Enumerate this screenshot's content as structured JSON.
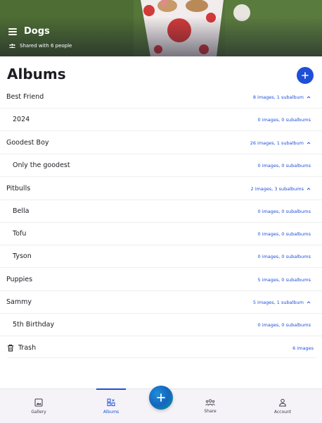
{
  "header": {
    "title": "Dogs",
    "shared_text": "Shared with 6 people",
    "menu_icon": "hamburger-icon",
    "shared_icon": "group-icon"
  },
  "albums": {
    "title": "Albums",
    "add_icon": "plus-icon",
    "items": [
      {
        "name": "Best Friend",
        "meta": "8 images, 1 subalbum",
        "expanded": true,
        "level": 0
      },
      {
        "name": "2024",
        "meta": "0 images, 0 subalbums",
        "level": 1
      },
      {
        "name": "Goodest Boy",
        "meta": "26 images, 1 subalbum",
        "expanded": true,
        "level": 0
      },
      {
        "name": "Only the goodest",
        "meta": "0 images, 0 subalbums",
        "level": 1
      },
      {
        "name": "Pitbulls",
        "meta": "2 images, 3 subalbums",
        "expanded": true,
        "level": 0
      },
      {
        "name": "Bella",
        "meta": "0 images, 0 subalbums",
        "level": 1
      },
      {
        "name": "Tofu",
        "meta": "0 images, 0 subalbums",
        "level": 1
      },
      {
        "name": "Tyson",
        "meta": "0 images, 0 subalbums",
        "level": 1
      },
      {
        "name": "Puppies",
        "meta": "5 images, 0 subalbums",
        "level": 0
      },
      {
        "name": "Sammy",
        "meta": "5 images, 1 subalbum",
        "expanded": true,
        "level": 0
      },
      {
        "name": "5th Birthday",
        "meta": "0 images, 0 subalbums",
        "level": 1
      }
    ],
    "trash": {
      "name": "Trash",
      "meta": "6 images",
      "icon": "trash-icon"
    }
  },
  "bottom_nav": {
    "items": [
      {
        "label": "Gallery",
        "icon": "gallery-icon"
      },
      {
        "label": "Albums",
        "icon": "albums-icon",
        "active": true
      },
      {
        "label": "Share",
        "icon": "share-icon"
      },
      {
        "label": "Account",
        "icon": "account-icon"
      }
    ],
    "fab_icon": "plus-icon"
  },
  "colors": {
    "accent": "#1f4fd8",
    "text": "#1c1c24",
    "nav_bg": "#f5f3f7"
  }
}
